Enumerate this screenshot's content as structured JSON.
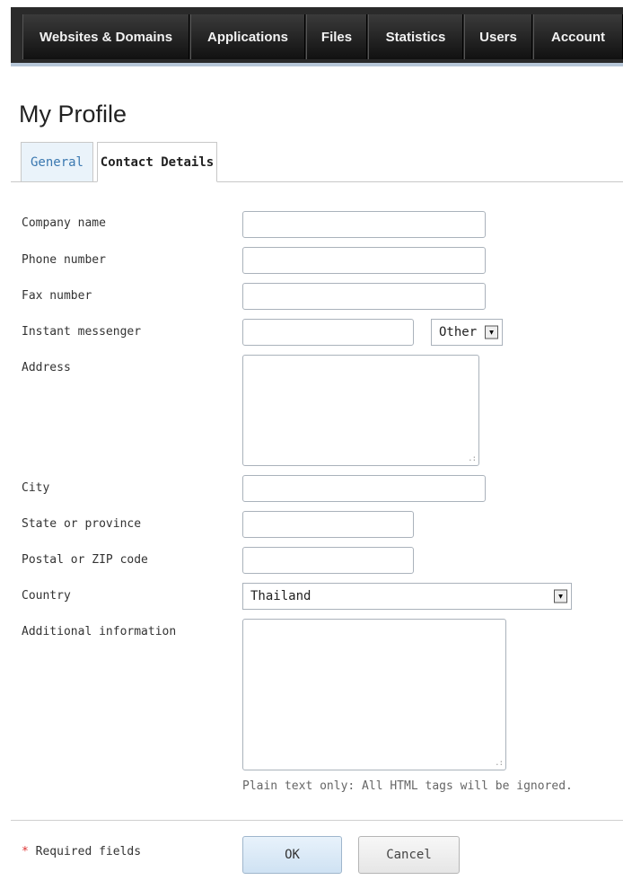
{
  "nav": {
    "tabs": [
      {
        "label": "Websites & Domains"
      },
      {
        "label": "Applications"
      },
      {
        "label": "Files"
      },
      {
        "label": "Statistics"
      },
      {
        "label": "Users"
      },
      {
        "label": "Account"
      }
    ]
  },
  "page": {
    "title": "My Profile",
    "tabs": [
      {
        "label": "General",
        "active": false
      },
      {
        "label": "Contact Details",
        "active": true
      }
    ]
  },
  "form": {
    "company_name": {
      "label": "Company name",
      "value": ""
    },
    "phone_number": {
      "label": "Phone number",
      "value": ""
    },
    "fax_number": {
      "label": "Fax number",
      "value": ""
    },
    "instant_messenger": {
      "label": "Instant messenger",
      "value": "",
      "type_selected": "Other"
    },
    "address": {
      "label": "Address",
      "value": ""
    },
    "city": {
      "label": "City",
      "value": ""
    },
    "state": {
      "label": "State or province",
      "value": ""
    },
    "postal": {
      "label": "Postal or ZIP code",
      "value": ""
    },
    "country": {
      "label": "Country",
      "selected": "Thailand"
    },
    "additional": {
      "label": "Additional information",
      "value": "",
      "hint": "Plain text only: All HTML tags will be ignored."
    }
  },
  "footer": {
    "required_star": "*",
    "required_label": " Required fields",
    "ok_label": "OK",
    "cancel_label": "Cancel"
  },
  "colors": {
    "nav_bg": "#1f1f1f",
    "tab_active_text": "#3a78b0",
    "required_star": "#dd3333"
  }
}
